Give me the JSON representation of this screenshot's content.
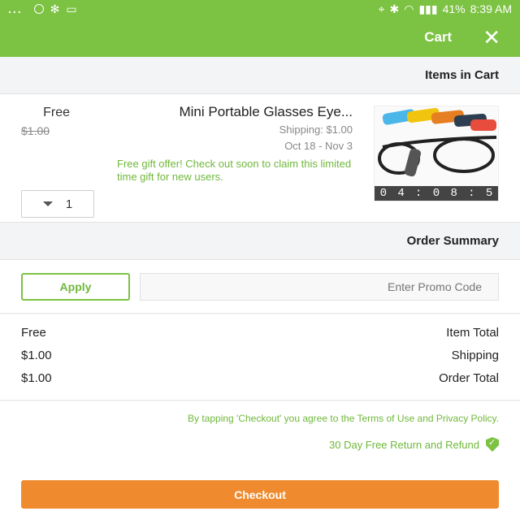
{
  "status_bar": {
    "time": "8:39 AM",
    "battery": "41%",
    "overflow": "..."
  },
  "app_bar": {
    "title": "Cart",
    "close_icon": "close-icon"
  },
  "items_section": {
    "header": "Items in Cart"
  },
  "cart_item": {
    "name": "Mini Portable Glasses Eye...",
    "shipping": "Shipping: $1.00",
    "dates": "Oct 18 - Nov 3",
    "gift_message": "Free gift offer! Check out soon to claim this limited time gift for new users.",
    "price": "Free",
    "original_price": "$1.00",
    "quantity": "1",
    "timer": [
      "0",
      "4",
      ":",
      "0",
      "8",
      ":",
      "5"
    ]
  },
  "order_summary": {
    "header": "Order Summary",
    "promo_placeholder": "Enter Promo Code",
    "apply_label": "Apply",
    "rows": [
      {
        "label": "Item Total",
        "value": "Free"
      },
      {
        "label": "Shipping",
        "value": "$1.00"
      },
      {
        "label": "Order Total",
        "value": "$1.00"
      }
    ]
  },
  "terms": {
    "text": "By tapping 'Checkout' you agree to the Terms of Use and Privacy Policy.",
    "refund": "30 Day Free Return and Refund"
  },
  "checkout": {
    "label": "Checkout"
  },
  "colors": {
    "primary_green": "#7cc243",
    "accent_orange": "#ef8b2e"
  }
}
